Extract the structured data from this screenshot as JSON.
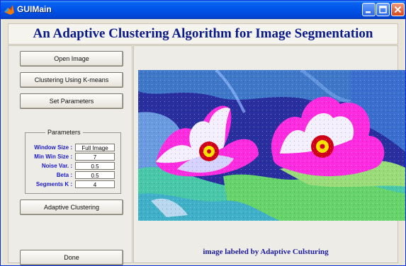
{
  "window": {
    "title": "GUIMain",
    "icon": "matlab-icon",
    "controls": [
      "minimize-icon",
      "maximize-icon",
      "close-icon"
    ]
  },
  "header": {
    "title": "An Adaptive Clustering Algorithm for Image Segmentation"
  },
  "buttons": {
    "open_image": "Open Image",
    "kmeans": "Clustering Using K-means",
    "set_parameters": "Set Parameters",
    "adaptive": "Adaptive Clustering",
    "done": "Done"
  },
  "parameters": {
    "title": "Parameters",
    "fields": [
      {
        "label": "Window Size :",
        "value": "Full Image"
      },
      {
        "label": "Min Win Size :",
        "value": "7"
      },
      {
        "label": "Noise Var. :",
        "value": "0.5"
      },
      {
        "label": "Beta :",
        "value": "0.5"
      },
      {
        "label": "Segments K :",
        "value": "4"
      }
    ]
  },
  "image": {
    "caption": "image labeled by Adaptive Culsturing"
  },
  "colors": {
    "title_blue": "#0a1a8a",
    "label_blue": "#1a1ad0",
    "panel": "#eeece6",
    "titlebar": "#0055ea"
  }
}
